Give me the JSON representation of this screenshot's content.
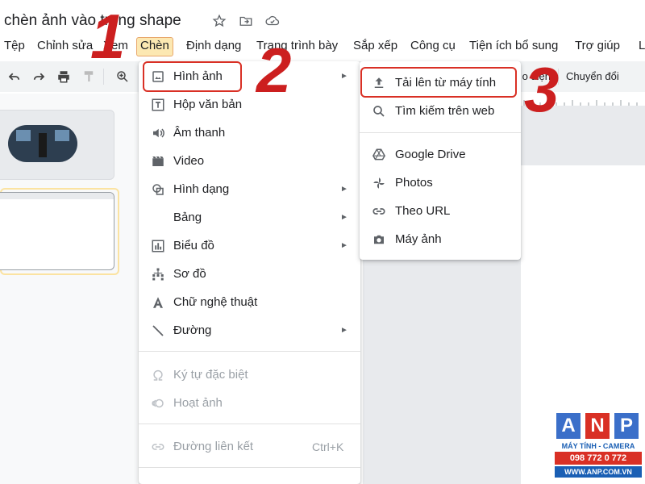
{
  "document": {
    "title": "chèn ảnh vào trong shape"
  },
  "menubar": {
    "items": [
      "Tệp",
      "Chỉnh sửa",
      "Xem",
      "Chèn",
      "Định dạng",
      "Trang trình bày",
      "Sắp xếp",
      "Công cụ",
      "Tiện ích bổ sung",
      "Trợ giúp"
    ],
    "active": "Chèn"
  },
  "toolbar": {
    "partial_label_1": "o diện",
    "label_2": "Chuyển đổi"
  },
  "insert_menu": {
    "items": [
      {
        "label": "Hình ảnh",
        "icon": "image-icon",
        "submenu": true,
        "enabled": true
      },
      {
        "label": "Hộp văn bản",
        "icon": "text-box-icon",
        "submenu": false,
        "enabled": true
      },
      {
        "label": "Âm thanh",
        "icon": "audio-icon",
        "submenu": false,
        "enabled": true
      },
      {
        "label": "Video",
        "icon": "video-icon",
        "submenu": false,
        "enabled": true
      },
      {
        "label": "Hình dạng",
        "icon": "shape-icon",
        "submenu": true,
        "enabled": true
      },
      {
        "label": "Bảng",
        "icon": "",
        "submenu": true,
        "enabled": true
      },
      {
        "label": "Biểu đồ",
        "icon": "chart-icon",
        "submenu": true,
        "enabled": true
      },
      {
        "label": "Sơ đồ",
        "icon": "diagram-icon",
        "submenu": false,
        "enabled": true
      },
      {
        "label": "Chữ nghệ thuật",
        "icon": "word-art-icon",
        "submenu": false,
        "enabled": true
      },
      {
        "label": "Đường",
        "icon": "line-icon",
        "submenu": true,
        "enabled": true
      },
      {
        "label": "Ký tự đặc biệt",
        "icon": "omega-icon",
        "submenu": false,
        "enabled": false
      },
      {
        "label": "Hoạt ảnh",
        "icon": "animation-icon",
        "submenu": false,
        "enabled": false
      },
      {
        "label": "Đường liên kết",
        "icon": "link-icon",
        "submenu": false,
        "enabled": false,
        "shortcut": "Ctrl+K"
      }
    ]
  },
  "image_submenu": {
    "items": [
      {
        "label": "Tải lên từ máy tính",
        "icon": "upload-icon"
      },
      {
        "label": "Tìm kiếm trên web",
        "icon": "search-icon"
      },
      {
        "label": "Google Drive",
        "icon": "google-drive-icon"
      },
      {
        "label": "Photos",
        "icon": "photos-pinwheel-icon"
      },
      {
        "label": "Theo URL",
        "icon": "link-icon"
      },
      {
        "label": "Máy ảnh",
        "icon": "camera-icon"
      }
    ]
  },
  "annotations": {
    "step1": "1",
    "step2": "2",
    "step3": "3",
    "highlight_color": "#d93025"
  },
  "watermark": {
    "letters": [
      "A",
      "N",
      "P"
    ],
    "subtitle": "MÁY TÍNH - CAMERA",
    "phone": "098 772 0 772",
    "website": "WWW.ANP.COM.VN",
    "colors": {
      "a": "#3b6fc9",
      "n": "#d93025",
      "p": "#3b6fc9"
    }
  }
}
